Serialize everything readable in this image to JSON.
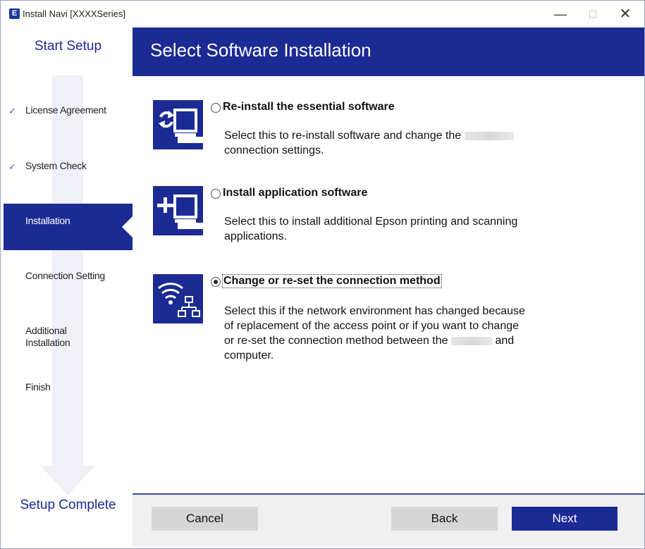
{
  "window": {
    "title": "Install Navi [XXXXSeries]",
    "app_icon_glyph": "E"
  },
  "sidebar": {
    "title": "Start Setup",
    "steps": [
      {
        "label": "License Agreement",
        "done": true
      },
      {
        "label": "System Check",
        "done": true
      },
      {
        "label": "Installation",
        "active": true
      },
      {
        "label": "Connection Setting"
      },
      {
        "label": "Additional Installation",
        "line1": "Additional",
        "line2": "Installation"
      },
      {
        "label": "Finish"
      }
    ],
    "check_glyph": "✓",
    "footer": "Setup Complete"
  },
  "header": {
    "title": "Select Software Installation"
  },
  "options": [
    {
      "icon": "reinstall-icon",
      "title": "Re-install the essential software",
      "desc_before": "Select this to re-install software and change the",
      "desc_after": "connection settings.",
      "selected": false
    },
    {
      "icon": "add-application-icon",
      "title": "Install application software",
      "desc_line1": "Select this to install additional Epson printing and scanning",
      "desc_line2": "applications.",
      "selected": false
    },
    {
      "icon": "wifi-network-icon",
      "title": "Change or re-set the connection method",
      "desc_line1": "Select this if the network environment has changed because",
      "desc_line2": "of replacement of the access point or if you want to change",
      "desc_line3_before": "or re-set the connection method between the",
      "desc_line3_after": "and",
      "desc_line4": "computer.",
      "selected": true
    }
  ],
  "buttons": {
    "cancel": "Cancel",
    "back": "Back",
    "next": "Next"
  },
  "colors": {
    "brand_blue": "#1c2a94",
    "button_gray": "#d6d6d6",
    "footer_bg": "#f0f0f0"
  }
}
